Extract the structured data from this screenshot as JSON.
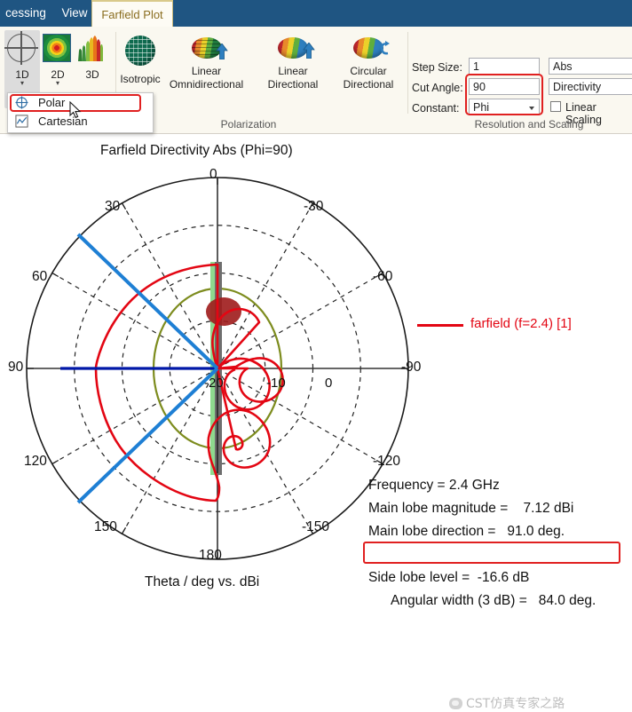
{
  "window": {
    "tabs": [
      {
        "label": "cessing",
        "active": false
      },
      {
        "label": "View",
        "active": false
      },
      {
        "label": "Farfield Plot",
        "active": true
      }
    ]
  },
  "ribbon": {
    "plot_type_group": {
      "items": [
        {
          "label": "1D",
          "icon": "polar-crosshair-icon",
          "selected": true,
          "has_caret": true
        },
        {
          "label": "2D",
          "icon": "contour-map-icon",
          "selected": false,
          "has_caret": true
        },
        {
          "label": "3D",
          "icon": "radiation-pattern-icon",
          "selected": false,
          "has_caret": false
        }
      ]
    },
    "polarization_group": {
      "title": "Polarization",
      "items": [
        {
          "label": "Isotropic",
          "icon": "globe-icon"
        },
        {
          "label": "Linear\nOmnidirectional",
          "line1": "Linear",
          "line2": "Omnidirectional",
          "icon": "linear-omni-icon"
        },
        {
          "label": "Linear\nDirectional",
          "line1": "Linear",
          "line2": "Directional",
          "icon": "linear-directional-icon"
        },
        {
          "label": "Circular\nDirectional",
          "line1": "Circular",
          "line2": "Directional",
          "icon": "circular-directional-icon"
        }
      ]
    },
    "resolution_group": {
      "title": "Resolution and Scaling",
      "fields": [
        {
          "label": "Step Size:",
          "value": "1",
          "type": "text",
          "highlighted": false
        },
        {
          "label": "Cut Angle:",
          "value": "90",
          "type": "text",
          "highlighted": true
        },
        {
          "label": "Constant:",
          "value": "Phi",
          "type": "combo",
          "highlighted": true
        }
      ],
      "right_controls": [
        {
          "value": "Abs",
          "type": "combo"
        },
        {
          "value": "Directivity",
          "type": "combo"
        }
      ],
      "checkbox": {
        "label": "Linear Scaling",
        "checked": false
      }
    },
    "dropdown_menu": {
      "open": true,
      "items": [
        {
          "label": "Polar",
          "icon": "polar-crosshair-icon",
          "highlighted": true
        },
        {
          "label": "Cartesian",
          "icon": "line-chart-icon",
          "highlighted": false
        }
      ]
    }
  },
  "chart_data": {
    "type": "line",
    "subtype": "polar",
    "title": "Farfield Directivity Abs (Phi=90)",
    "xlabel": "Theta / deg vs. dBi",
    "legend": [
      {
        "label": "farfield (f=2.4) [1]",
        "color": "#E30613"
      }
    ],
    "legend_position": "top-right",
    "angular_ticks": [
      "0",
      "30",
      "60",
      "90",
      "120",
      "150",
      "180",
      "-150",
      "-120",
      "-90",
      "-60",
      "-30"
    ],
    "angular_unit": "deg",
    "radial_ticks": [
      "-20",
      "-10",
      "0"
    ],
    "radial_unit": "dBi",
    "rlim": [
      -30,
      10
    ],
    "grid": true,
    "series": [
      {
        "name": "farfield (f=2.4) [1]",
        "color": "#E30613",
        "theta": [
          0,
          10,
          20,
          30,
          40,
          50,
          60,
          70,
          80,
          90,
          100,
          110,
          120,
          130,
          140,
          150,
          160,
          170,
          180,
          190,
          200,
          210,
          220,
          230,
          240,
          250,
          260,
          270,
          280,
          290,
          300,
          310,
          320,
          330,
          340,
          350
        ],
        "values_dBi": [
          -6.5,
          -3.0,
          0.5,
          3.0,
          4.9,
          6.1,
          6.8,
          7.1,
          7.12,
          7.1,
          6.8,
          6.2,
          5.2,
          3.6,
          1.4,
          -1.6,
          -5.6,
          -11.0,
          -16.6,
          -11.5,
          -7.0,
          -6.3,
          -8.5,
          -13.0,
          -19.5,
          -16.6,
          -14.0,
          -13.5,
          -14.5,
          -18.0,
          -24.0,
          -21.0,
          -19.0,
          -18.5,
          -17.0,
          -12.0
        ]
      },
      {
        "name": "antenna-structure-outline",
        "color": "#7D8C1E",
        "kind": "reference-circle"
      }
    ],
    "annotations": [
      {
        "name": "main-lobe-direction-marker",
        "color": "#0018A8",
        "angle_deg": 91
      },
      {
        "name": "angular-width-marker-upper",
        "color": "#1E7FD4",
        "angle_deg": 49
      },
      {
        "name": "angular-width-marker-lower",
        "color": "#1E7FD4",
        "angle_deg": 133
      }
    ],
    "results": [
      {
        "label": "Frequency = ",
        "value": "2.4 GHz",
        "text": "Frequency = 2.4 GHz",
        "highlighted": false
      },
      {
        "label": "Main lobe magnitude = ",
        "value": "7.12 dBi",
        "text": "Main lobe magnitude =    7.12 dBi",
        "highlighted": false
      },
      {
        "label": "Main lobe direction = ",
        "value": "91.0 deg.",
        "text": "Main lobe direction =   91.0 deg.",
        "highlighted": false
      },
      {
        "label": "Angular width (3 dB) = ",
        "value": "84.0 deg.",
        "text": "Angular width (3 dB) =   84.0 deg.",
        "highlighted": true
      },
      {
        "label": "Side lobe level = ",
        "value": "-16.6 dB",
        "text": "Side lobe level =  -16.6 dB",
        "highlighted": false
      }
    ]
  },
  "watermark": {
    "text": "CST仿真专家之路",
    "logo": "wechat-logo-icon"
  }
}
